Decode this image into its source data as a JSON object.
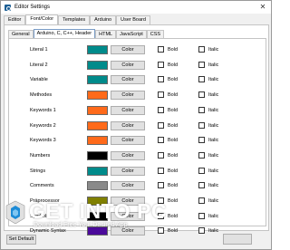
{
  "window": {
    "title": "Editor Settings"
  },
  "top_tabs": [
    "Editor",
    "Font/Color",
    "Templates",
    "Arduino",
    "User Board"
  ],
  "top_tab_active": "Font/Color",
  "sub_tabs": [
    "General",
    "Arduino, C, C++, Header",
    "HTML",
    "JavaScript",
    "CSS"
  ],
  "sub_tab_active": "Arduino, C, C++, Header",
  "color_button_label": "Color",
  "bold_label": "Bold",
  "italic_label": "Italic",
  "rows": [
    {
      "label": "Literal 1",
      "color": "#008b8b"
    },
    {
      "label": "Literal 2",
      "color": "#008b8b"
    },
    {
      "label": "Variable",
      "color": "#008b8b"
    },
    {
      "label": "Methodes",
      "color": "#ff6a1a"
    },
    {
      "label": "Keywords 1",
      "color": "#ff6a1a"
    },
    {
      "label": "Keywords 2",
      "color": "#ff6a1a"
    },
    {
      "label": "Keywords 3",
      "color": "#ff6a1a"
    },
    {
      "label": "Numbers",
      "color": "#000000"
    },
    {
      "label": "Strings",
      "color": "#008b8b"
    },
    {
      "label": "Comments",
      "color": "#8a8a8a"
    },
    {
      "label": "Präprocessor",
      "color": "#808000"
    },
    {
      "label": "Symbols",
      "color": "#000000"
    },
    {
      "label": "Dynamic Syntax",
      "color": "#4b0a9a"
    }
  ],
  "buttons": {
    "set_default": "Set Default"
  },
  "watermark": {
    "brand": "GET INTO PC",
    "tagline": "Download Free Your Desired App"
  }
}
